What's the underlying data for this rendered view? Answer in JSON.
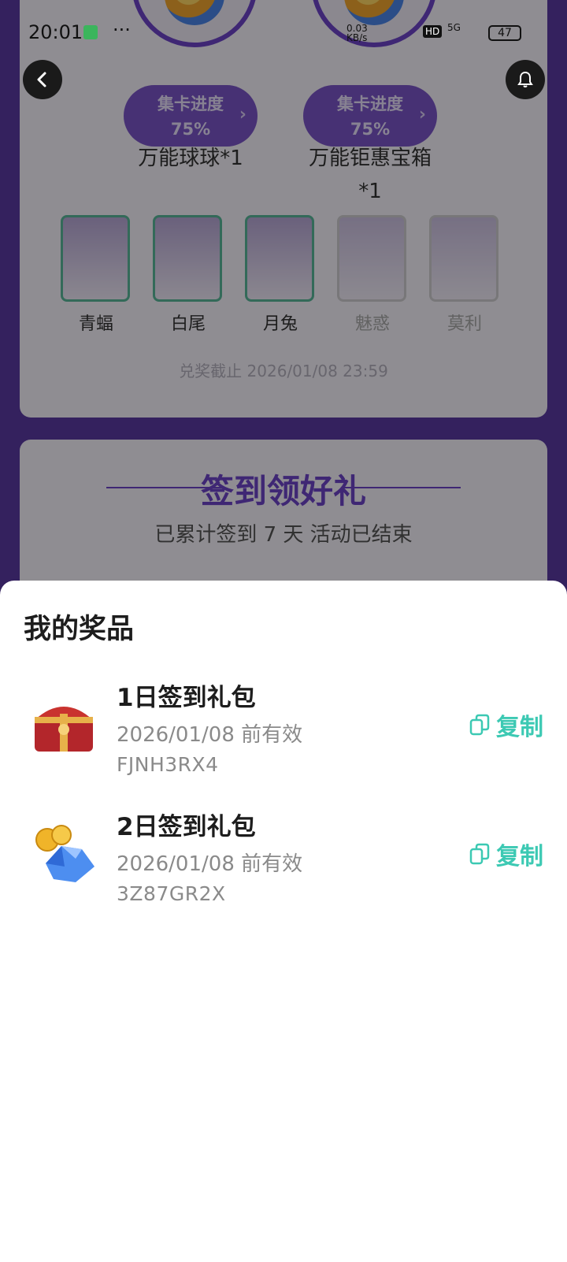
{
  "status_bar": {
    "time": "20:01",
    "dots": "···",
    "net_speed": "0.03 KB/s",
    "signal": "5G",
    "hd": "HD",
    "battery": "47"
  },
  "top_rewards": [
    {
      "progress_label": "集卡进度",
      "progress_value": "75%",
      "name": "万能球球*1"
    },
    {
      "progress_label": "集卡进度",
      "progress_value": "75%",
      "name": "万能钜惠宝箱*1"
    }
  ],
  "characters": [
    {
      "name": "青蝠",
      "collected": true
    },
    {
      "name": "白尾",
      "collected": true
    },
    {
      "name": "月兔",
      "collected": true
    },
    {
      "name": "魅惑",
      "collected": false
    },
    {
      "name": "莫利",
      "collected": false
    }
  ],
  "deadline": "兑奖截止 2026/01/08 23:59",
  "signin": {
    "title": "签到领好礼",
    "subtitle": "已累计签到 7 天  活动已结束"
  },
  "sheet": {
    "title": "我的奖品",
    "copy_label": "复制",
    "prizes": [
      {
        "name": "1日签到礼包",
        "valid": "2026/01/08 前有效",
        "code": "FJNH3RX4",
        "icon": "treasure-chest-icon"
      },
      {
        "name": "2日签到礼包",
        "valid": "2026/01/08 前有效",
        "code": "3Z87GR2X",
        "icon": "coins-gems-icon"
      }
    ]
  },
  "colors": {
    "accent": "#3cc9b3",
    "purple": "#6d44c9"
  }
}
